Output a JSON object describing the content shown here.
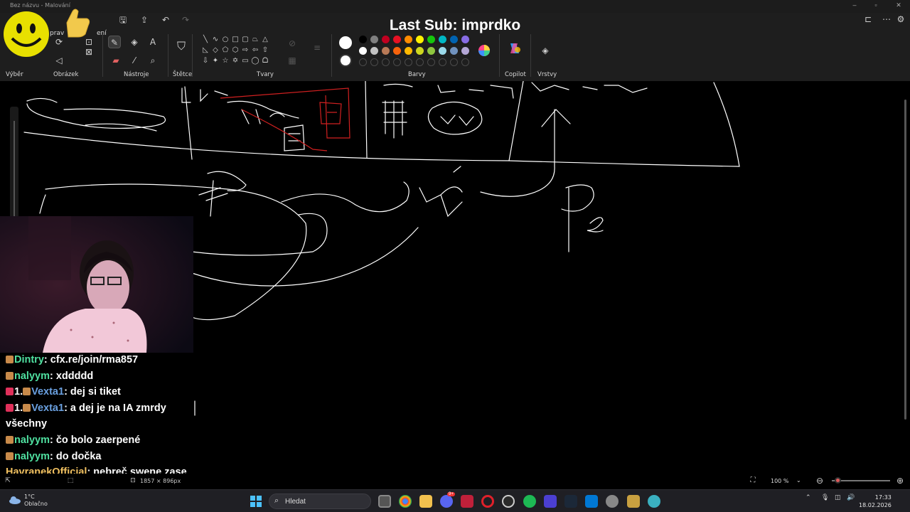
{
  "window": {
    "app_title": "Bez názvu - Malování"
  },
  "overlay": {
    "stream_title": "Last Sub: imprdko"
  },
  "ribbon": {
    "menu_partial_1": "prav",
    "menu_partial_2": "ení",
    "groups": {
      "selection": "Výběr",
      "image": "Obrázek",
      "tools": "Nástroje",
      "brushes": "Štětce",
      "shapes": "Tvary",
      "colors": "Barvy",
      "copilot": "Copilot",
      "layers": "Vrstvy"
    },
    "current_colors": [
      "#ffffff",
      "#ffffff"
    ],
    "palette_row1": [
      "#000000",
      "#7f7f7f",
      "#c00020",
      "#e81123",
      "#ff8c00",
      "#fff100",
      "#16c60c",
      "#00b7c3",
      "#0063b1",
      "#886ce4"
    ],
    "palette_row2": [
      "#ffffff",
      "#c3c3c3",
      "#b97a57",
      "#f7630c",
      "#ffb900",
      "#cdd71f",
      "#8ec63f",
      "#9ad8e8",
      "#7092be",
      "#b4a7d6"
    ]
  },
  "chat": {
    "messages": [
      {
        "user": "Dintry",
        "text": ": cfx.re/join/rma857",
        "color": "#4fe0a0"
      },
      {
        "user": "nalyym",
        "text": ": xddddd",
        "color": "#4fe0a0"
      },
      {
        "user": "Vexta1",
        "text": ": dej si tiket",
        "color": "#6aa0e0"
      },
      {
        "user": "Vexta1",
        "text": ": a dej je na IA zmrdy",
        "color": "#6aa0e0"
      },
      {
        "user": "",
        "text": "všechny",
        "color": "#ffffff"
      },
      {
        "user": "nalyym",
        "text": ": čo bolo zaerpené",
        "color": "#4fe0a0"
      },
      {
        "user": "nalyym",
        "text": ": do dočka",
        "color": "#4fe0a0"
      },
      {
        "user": "HavranekOfficial",
        "text": ": nebreč swene zase",
        "color": "#f0c060"
      }
    ],
    "badge_text": "1."
  },
  "statusbar": {
    "dimensions": "1857 × 896px",
    "zoom": "100 %",
    "zoom_fraction": 0.1
  },
  "taskbar": {
    "weather_temp": "1°C",
    "weather_desc": "Oblačno",
    "search_placeholder": "Hledat",
    "time": "17:33",
    "date": "18.02.2026",
    "discord_badge": "9+"
  }
}
